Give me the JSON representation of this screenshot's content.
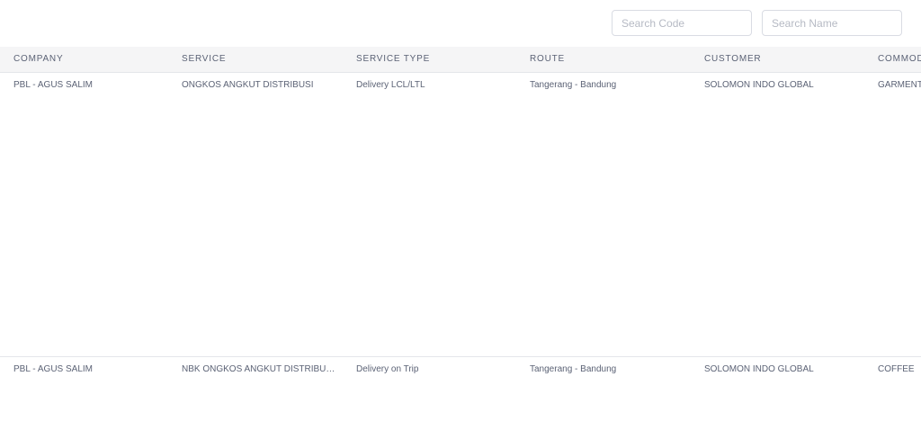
{
  "search": {
    "code_placeholder": "Search Code",
    "name_placeholder": "Search Name"
  },
  "table": {
    "columns": [
      "COMPANY",
      "SERVICE",
      "SERVICE TYPE",
      "ROUTE",
      "CUSTOMER",
      "COMMOD"
    ],
    "rows": [
      {
        "company": "PBL - AGUS SALIM",
        "service": "ONGKOS ANGKUT DISTRIBUSI",
        "service_type": "Delivery LCL/LTL",
        "route": "Tangerang - Bandung",
        "customer": "SOLOMON INDO GLOBAL",
        "commodity": "GARMENT"
      },
      {
        "company": "PBL - AGUS SALIM",
        "service": "NBK ONGKOS ANGKUT DISTRIBUS...",
        "service_type": "Delivery on Trip",
        "route": "Tangerang - Bandung",
        "customer": "SOLOMON INDO GLOBAL",
        "commodity": "COFFEE"
      }
    ]
  }
}
